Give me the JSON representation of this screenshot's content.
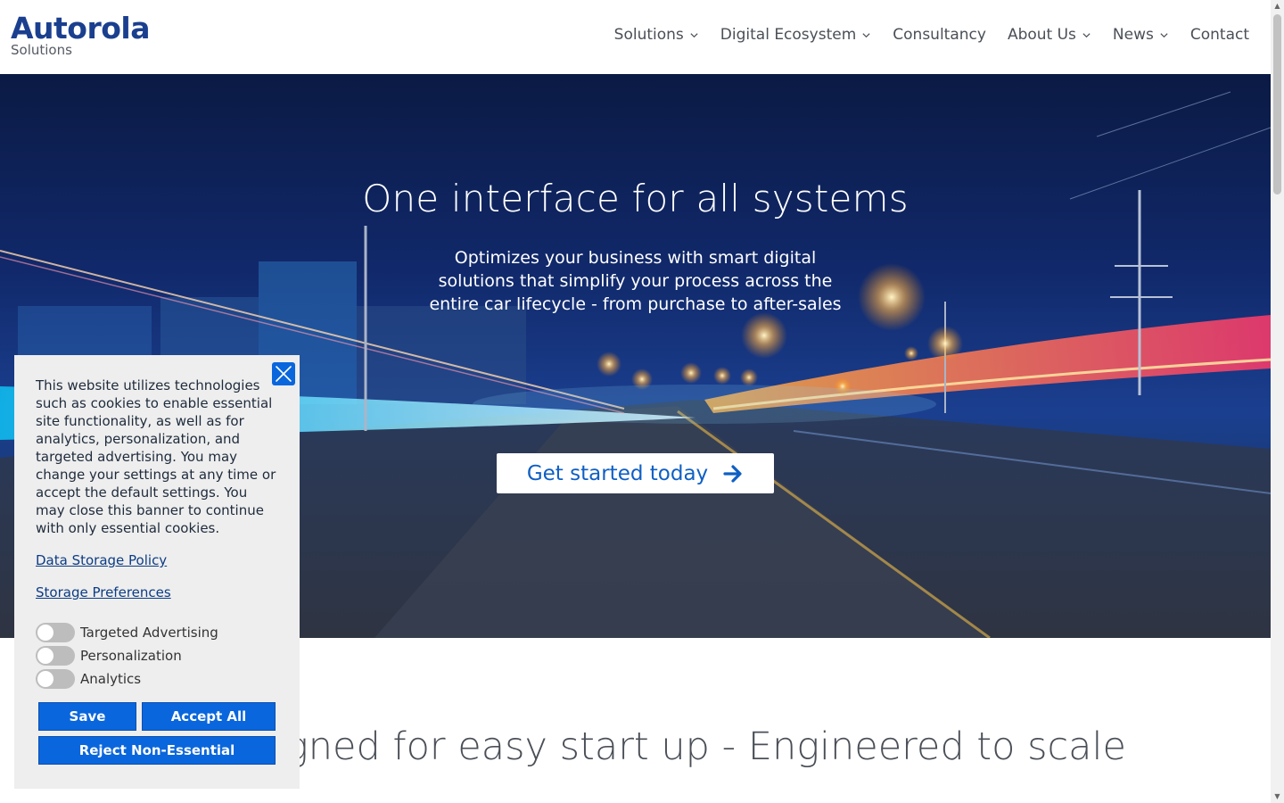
{
  "header": {
    "logo_main": "Autorola",
    "logo_sub": "Solutions",
    "nav": [
      {
        "label": "Solutions",
        "has_dropdown": true
      },
      {
        "label": "Digital Ecosystem",
        "has_dropdown": true
      },
      {
        "label": "Consultancy",
        "has_dropdown": false
      },
      {
        "label": "About Us",
        "has_dropdown": true
      },
      {
        "label": "News",
        "has_dropdown": true
      },
      {
        "label": "Contact",
        "has_dropdown": false
      }
    ]
  },
  "hero": {
    "title": "One interface for all systems",
    "subtitle": "Optimizes your business with smart digital solutions that simplify your process across the entire car lifecycle - from purchase to after-sales",
    "cta_label": "Get started today",
    "cta_icon": "arrow-right-icon"
  },
  "section": {
    "heading": "gned for easy start up -  Engineered to scale"
  },
  "cookie": {
    "text": "This website utilizes technologies such as cookies to enable essential site functionality, as well as for analytics, personalization, and targeted advertising. You may change your settings at any time or accept the default settings. You may close this banner to continue with only essential cookies.",
    "link_policy": "Data Storage Policy",
    "link_prefs": "Storage Preferences",
    "toggles": [
      {
        "label": "Targeted Advertising",
        "on": false
      },
      {
        "label": "Personalization",
        "on": false
      },
      {
        "label": "Analytics",
        "on": false
      }
    ],
    "save_label": "Save",
    "accept_label": "Accept All",
    "reject_label": "Reject Non-Essential",
    "close_icon": "close-icon"
  },
  "colors": {
    "brand": "#1b3f8f",
    "accent": "#0a66dc",
    "cta_text": "#0f5fc4"
  }
}
